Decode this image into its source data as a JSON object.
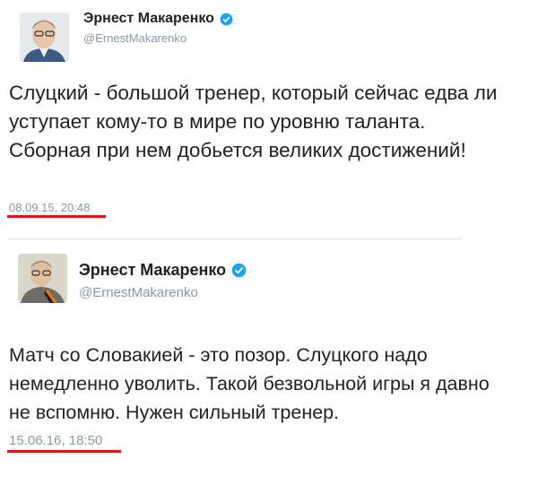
{
  "tweets": [
    {
      "display_name": "Эрнест Макаренко",
      "handle": "@ErnestMakarenko",
      "text": "Слуцкий - большой тренер, который сейчас едва ли уступает кому-то в мире по уровню таланта. Сборная при нем добьется великих достижений!",
      "timestamp": "08.09.15, 20:48"
    },
    {
      "display_name": "Эрнест Макаренко",
      "handle": "@ErnestMakarenko",
      "text": "Матч со Словакией - это позор. Слуцкого надо немедленно уволить. Такой безвольной игры я давно не вспомню. Нужен сильный тренер.",
      "timestamp": "15.06.16, 18:50"
    }
  ],
  "colors": {
    "verified_blue": "#1da1f2",
    "highlight_underline": "#e0141a",
    "muted_text": "#8899a6"
  },
  "icons": {
    "verified": "verified-badge-icon"
  }
}
